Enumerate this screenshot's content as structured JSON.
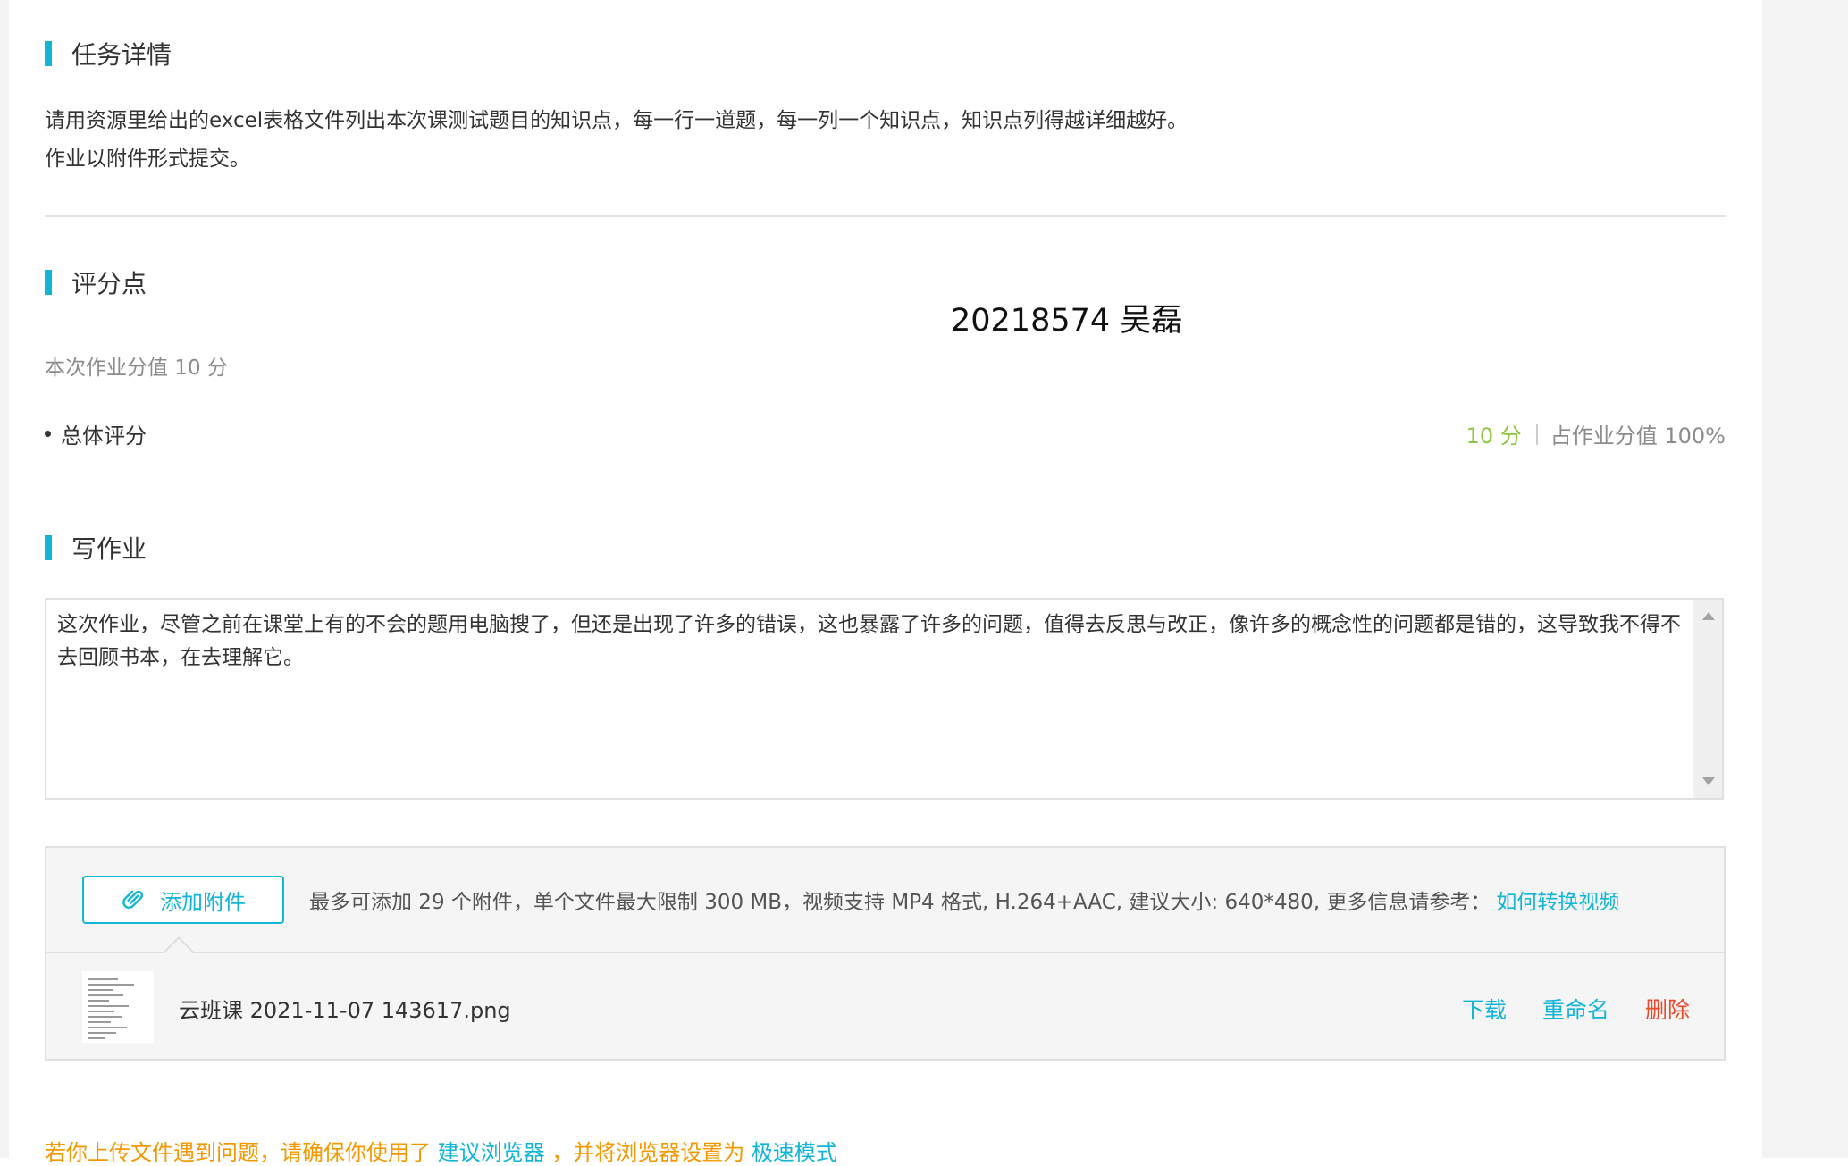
{
  "task": {
    "title": "任务详情",
    "description_line1": "请用资源里给出的excel表格文件列出本次课测试题目的知识点，每一行一道题，每一列一个知识点，知识点列得越详细越好。",
    "description_line2": "作业以附件形式提交。"
  },
  "grading": {
    "title": "评分点",
    "total_note": "本次作业分值 10 分",
    "criterion_label": "总体评分",
    "criterion_points": "10 分",
    "criterion_share": "占作业分值 100%"
  },
  "student": {
    "id_name": "20218574 吴磊"
  },
  "write": {
    "title": "写作业",
    "answer_text": "这次作业，尽管之前在课堂上有的不会的题用电脑搜了，但还是出现了许多的错误，这也暴露了许多的问题，值得去反思与改正，像许多的概念性的问题都是错的，这导致我不得不去回顾书本，在去理解它。"
  },
  "attachments": {
    "add_button": "添加附件",
    "info_text": "最多可添加 29 个附件，单个文件最大限制 300 MB，视频支持 MP4 格式, H.264+AAC, 建议大小: 640*480, 更多信息请参考：",
    "info_link": "如何转换视频",
    "files": [
      {
        "name": "云班课 2021-11-07 143617.png",
        "download": "下载",
        "rename": "重命名",
        "delete": "删除"
      }
    ]
  },
  "tip": {
    "part1": "若你上传文件遇到问题，请确保你使用了",
    "link1": "建议浏览器",
    "part2": "，并将浏览器设置为",
    "link2": "极速模式"
  },
  "colors": {
    "accent": "#13b5d6",
    "points_green": "#8dc63f",
    "danger": "#e84a2b",
    "warning": "#f39800"
  },
  "icons": {
    "add_attachment": "paperclip-icon",
    "file_thumbnail": "image-thumbnail-icon"
  }
}
